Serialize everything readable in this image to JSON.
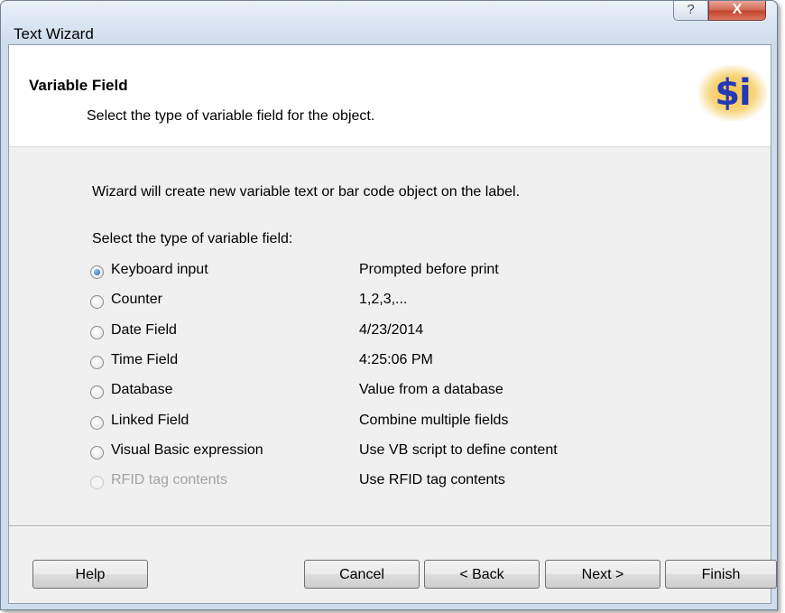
{
  "window": {
    "title": "Text Wizard",
    "help_glyph": "?",
    "close_glyph": "X"
  },
  "header": {
    "title": "Variable Field",
    "subtitle": "Select the type of variable field for the object.",
    "logo_text": "$i"
  },
  "body": {
    "intro": "Wizard will create new variable text or bar code object on the label.",
    "select_label": "Select the type of variable field:"
  },
  "options": [
    {
      "label": "Keyboard input",
      "description": "Prompted before print",
      "checked": true,
      "enabled": true
    },
    {
      "label": "Counter",
      "description": "1,2,3,...",
      "checked": false,
      "enabled": true
    },
    {
      "label": "Date Field",
      "description": "4/23/2014",
      "checked": false,
      "enabled": true
    },
    {
      "label": "Time Field",
      "description": "4:25:06 PM",
      "checked": false,
      "enabled": true
    },
    {
      "label": "Database",
      "description": "Value from a database",
      "checked": false,
      "enabled": true
    },
    {
      "label": "Linked Field",
      "description": "Combine multiple fields",
      "checked": false,
      "enabled": true
    },
    {
      "label": "Visual Basic expression",
      "description": "Use VB script to define content",
      "checked": false,
      "enabled": true
    },
    {
      "label": "RFID tag contents",
      "description": "Use RFID tag contents",
      "checked": false,
      "enabled": false
    }
  ],
  "buttons": {
    "help": "Help",
    "cancel": "Cancel",
    "back": "< Back",
    "next": "Next >",
    "finish": "Finish"
  },
  "colors": {
    "logo_text": "#2338b6",
    "logo_glow": "#f5c34b",
    "close_button": "#c5442e"
  }
}
